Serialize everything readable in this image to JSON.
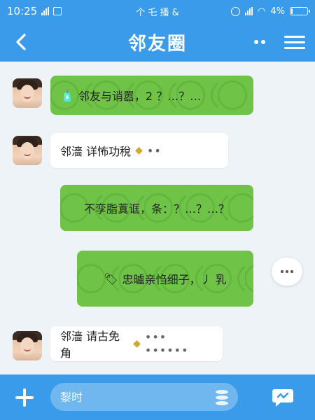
{
  "status_bar": {
    "time": "10:25",
    "center_text": "个 乇 播 &",
    "battery_percent": "4%",
    "battery_level": 0.04
  },
  "header": {
    "title": "邻友圈"
  },
  "messages": [
    {
      "side": "right",
      "style": "green",
      "icon": "bottle-icon",
      "text": "邻友与诮嚣，2 ？…？…"
    },
    {
      "side": "left",
      "style": "white",
      "text": "邻濇 详怖功稅",
      "suffix": "••"
    },
    {
      "side": "right",
      "style": "green",
      "text": "不孪脂蒖诓，条：？…？…？"
    },
    {
      "side": "right",
      "style": "green",
      "icon": "tag-icon",
      "text": "忠曥亲㤘细子，丿 乳"
    },
    {
      "side": "left",
      "style": "white",
      "text": "邻濇 请古免角",
      "suffix": "••• ••••••"
    }
  ],
  "composer": {
    "placeholder": "㴝时"
  },
  "colors": {
    "brand": "#3a9bea",
    "bubble_green": "#6fc346",
    "bubble_white": "#ffffff",
    "background": "#eef3f8"
  }
}
